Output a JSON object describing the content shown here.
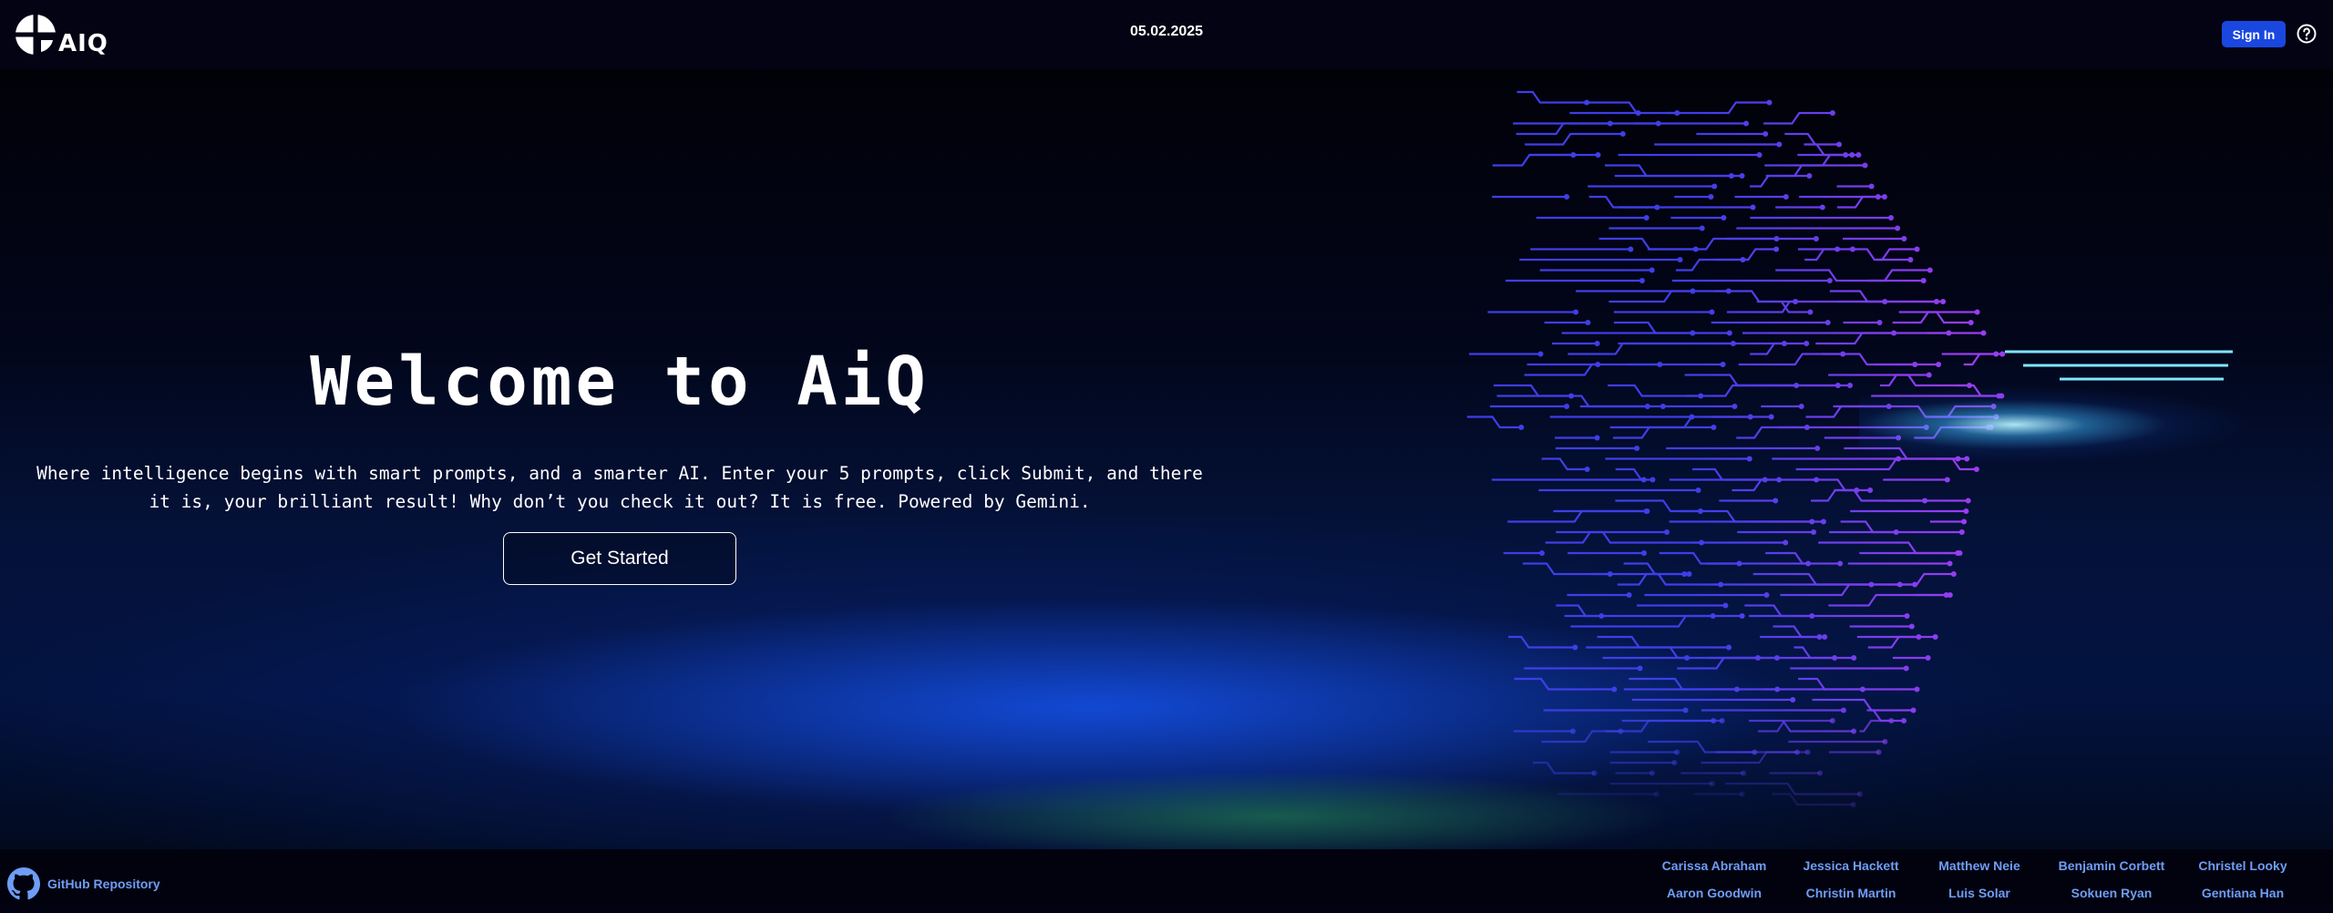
{
  "header": {
    "logo_text": "AIQ",
    "date": "05.02.2025",
    "sign_in_label": "Sign In"
  },
  "hero": {
    "title": "Welcome to AiQ",
    "description": "Where intelligence begins with smart prompts, and a smarter AI. Enter your 5 prompts, click Submit, and there it is, your brilliant result! Why don’t you check it out? It is free. Powered by Gemini.",
    "cta_label": "Get Started"
  },
  "footer": {
    "github_label": "GitHub Repository",
    "contributors": [
      [
        "Carissa Abraham",
        "Aaron Goodwin"
      ],
      [
        "Jessica Hackett",
        "Christin Martin"
      ],
      [
        "Matthew Neie",
        "Luis Solar"
      ],
      [
        "Benjamin Corbett",
        "Sokuen Ryan"
      ],
      [
        "Christel Looky",
        "Gentiana Han"
      ]
    ]
  },
  "icons": {
    "logo": "aiq-logo-icon",
    "help": "question-circle-icon",
    "github": "github-icon"
  },
  "colors": {
    "sign_in_bg": "#1a47e0",
    "footer_link": "#6f9df5",
    "circuit_left": "#3f3ee8",
    "circuit_right": "#9a3df2",
    "beam": "#7fe6ff"
  }
}
